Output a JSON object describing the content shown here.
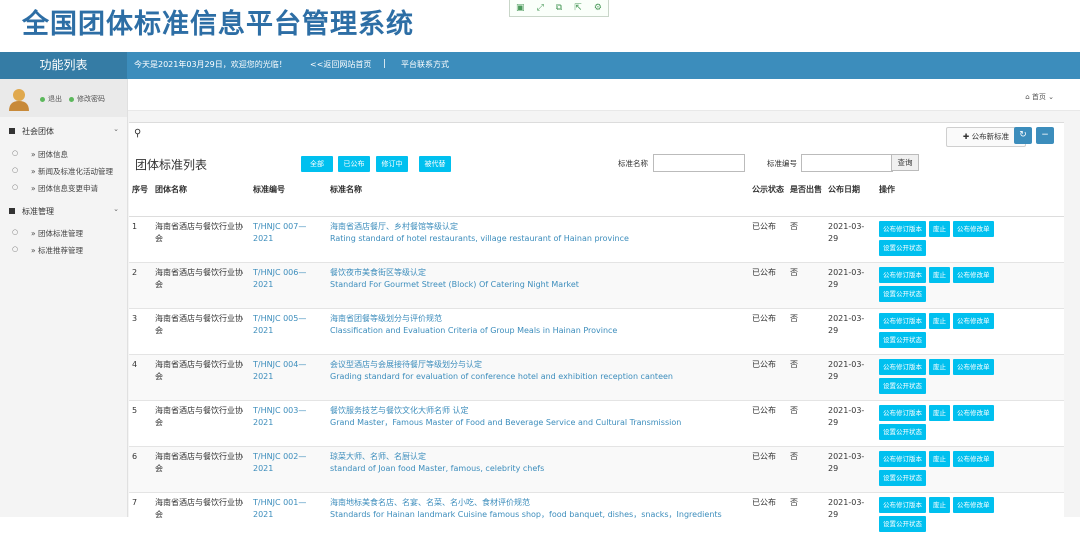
{
  "header": {
    "title": "全国团体标准信息平台管理系统",
    "toolbox_icons": [
      "doc-icon",
      "expand-icon",
      "copy-icon",
      "export-icon",
      "settings-icon"
    ]
  },
  "navbar": {
    "function_list": "功能列表",
    "greeting": "今天是2021年03月29日，欢迎您的光临！",
    "back_home": "<<返回网站首页",
    "separator": "|",
    "contact": "平台联系方式"
  },
  "sidebar": {
    "user_links": {
      "logout": "退出",
      "change_password": "修改密码"
    },
    "groups": [
      {
        "label": "社会团体",
        "items": [
          "» 团体信息",
          "» 新闻及标准化活动管理",
          "» 团体信息变更申请"
        ]
      },
      {
        "label": "标准管理",
        "items": [
          "» 团体标准管理",
          "» 标准推荐管理"
        ]
      }
    ]
  },
  "breadcrumb": {
    "home": "首页"
  },
  "panel": {
    "publish_button": "公布新标准",
    "title": "团体标准列表",
    "filters": [
      "全部",
      "已公布",
      "修订中",
      "被代替"
    ],
    "search": {
      "name_label": "标准名称",
      "code_label": "标准编号",
      "query_button": "查询",
      "name_value": "",
      "code_value": ""
    }
  },
  "table": {
    "headers": [
      "序号",
      "团体名称",
      "标准编号",
      "标准名称",
      "公示状态",
      "是否出售",
      "公布日期",
      "操作"
    ],
    "rows": [
      {
        "no": "1",
        "org": "海南省酒店与餐饮行业协会",
        "code": "T/HNJC 007—2021",
        "name_cn": "海南省酒店餐厅、乡村餐馆等级认定",
        "name_en": "Rating standard of hotel restaurants, village restaurant of Hainan province",
        "status": "已公布",
        "sale": "否",
        "date": "2021-03-29"
      },
      {
        "no": "2",
        "org": "海南省酒店与餐饮行业协会",
        "code": "T/HNJC 006—2021",
        "name_cn": "餐饮夜市美食街区等级认定",
        "name_en": "Standard For Gourmet Street (Block) Of Catering Night Market",
        "status": "已公布",
        "sale": "否",
        "date": "2021-03-29"
      },
      {
        "no": "3",
        "org": "海南省酒店与餐饮行业协会",
        "code": "T/HNJC 005—2021",
        "name_cn": "海南省团餐等级划分与评价规范",
        "name_en": "Classification and Evaluation Criteria of Group Meals in Hainan Province",
        "status": "已公布",
        "sale": "否",
        "date": "2021-03-29"
      },
      {
        "no": "4",
        "org": "海南省酒店与餐饮行业协会",
        "code": "T/HNJC 004—2021",
        "name_cn": "会议型酒店与会展接待餐厅等级划分与认定",
        "name_en": "Grading standard for evaluation of conference hotel and exhibition reception canteen",
        "status": "已公布",
        "sale": "否",
        "date": "2021-03-29"
      },
      {
        "no": "5",
        "org": "海南省酒店与餐饮行业协会",
        "code": "T/HNJC 003—2021",
        "name_cn": "餐饮服务技艺与餐饮文化大师名师 认定",
        "name_en": "Grand Master，Famous Master of Food and Beverage Service and Cultural Transmission",
        "status": "已公布",
        "sale": "否",
        "date": "2021-03-29"
      },
      {
        "no": "6",
        "org": "海南省酒店与餐饮行业协会",
        "code": "T/HNJC 002—2021",
        "name_cn": "琼菜大师、名师、名厨认定",
        "name_en": "standard of Joan food Master, famous, celebrity chefs",
        "status": "已公布",
        "sale": "否",
        "date": "2021-03-29"
      },
      {
        "no": "7",
        "org": "海南省酒店与餐饮行业协会",
        "code": "T/HNJC 001—2021",
        "name_cn": "海南地标美食名店、名宴、名菜、名小吃、食材评价规范",
        "name_en": "Standards for Hainan landmark Cuisine famous shop，food banquet, dishes，snacks，Ingredients",
        "status": "已公布",
        "sale": "否",
        "date": "2021-03-29"
      }
    ],
    "row_actions": [
      "公布修订版本",
      "废止",
      "公布修改单",
      "设置公开状态"
    ]
  },
  "colors": {
    "primary": "#3c8dbc",
    "info": "#00c0ef",
    "title": "#2d6ea5"
  }
}
